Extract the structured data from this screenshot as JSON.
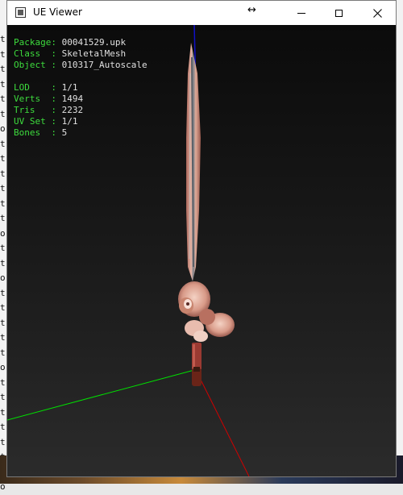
{
  "window": {
    "title": "UE Viewer",
    "resize_cursor": "↔"
  },
  "background": {
    "left_chars": [
      "t",
      "t",
      "t",
      "t",
      "t",
      "t",
      "o",
      "t",
      "t",
      "t",
      "t",
      "t",
      "t",
      "o",
      "t",
      "t",
      "o",
      "t",
      "t",
      "t",
      "t",
      "t",
      "o",
      "t",
      "t",
      "t",
      "t",
      "t",
      "t",
      "t",
      "o"
    ],
    "right_chars": [
      "",
      "",
      "",
      "",
      "",
      "",
      "",
      "",
      "",
      "",
      "",
      "",
      "",
      "",
      "",
      "",
      "",
      "",
      "",
      "",
      "",
      "",
      "",
      "",
      "",
      "",
      "",
      "",
      "",
      "",
      ""
    ]
  },
  "info": {
    "package_key": "Package:",
    "package_val": "00041529.upk",
    "class_key": "Class  :",
    "class_val": "SkeletalMesh",
    "object_key": "Object :",
    "object_val": "010317_Autoscale",
    "lod_key": "LOD    :",
    "lod_val": "1/1",
    "verts_key": "Verts  :",
    "verts_val": "1494",
    "tris_key": "Tris   :",
    "tris_val": "2232",
    "uvset_key": "UV Set :",
    "uvset_val": "1/1",
    "bones_key": "Bones  :",
    "bones_val": "5"
  },
  "colors": {
    "axis_x": "#ff0000",
    "axis_y": "#00ff00",
    "axis_z": "#0000ff",
    "label_green": "#3ddc3d"
  },
  "icons": {
    "app": "app-icon",
    "minimize": "minimize-icon",
    "maximize": "maximize-icon",
    "close": "close-icon"
  }
}
